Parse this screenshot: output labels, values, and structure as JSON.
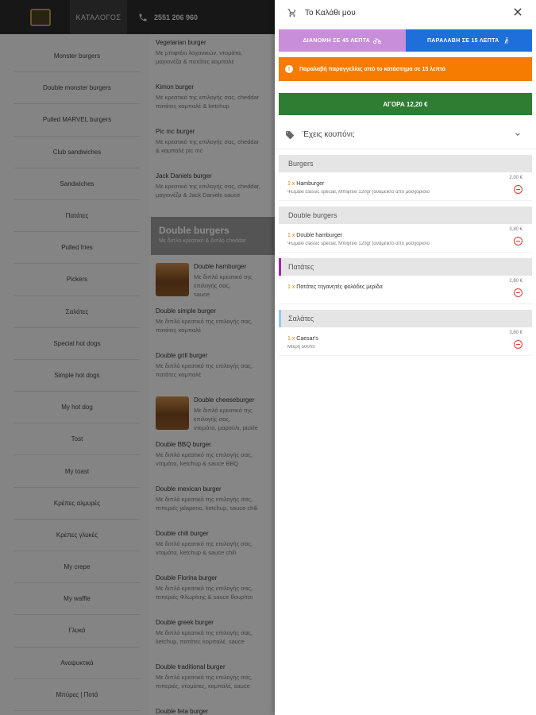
{
  "header": {
    "catalog_label": "ΚΑΤΑΛΟΓΟΣ",
    "phone": "2551 206 960"
  },
  "categories": [
    "Monster burgers",
    "Double monster burgers",
    "Pulled MARVEL burgers",
    "Club sandwiches",
    "Sandwiches",
    "Πατάτες",
    "Pulled fries",
    "Pickers",
    "Σαλάτες",
    "Special hot dogs",
    "Simple hot dogs",
    "My hot dog",
    "Tost",
    "My toast",
    "Κρέπες αλμυρές",
    "Κρέπες γλυκές",
    "My crepe",
    "My waffle",
    "Γλυκά",
    "Αναψυκτικά",
    "Μπύρες | Ποτά"
  ],
  "products_top": [
    {
      "name": "Vegetarian burger",
      "desc": "Με μπιφτέκι λαχανικών, ντομάτα,\nμαγιονέζα & πατάτες κομπαλέ"
    },
    {
      "name": "Kimon burger",
      "desc": "Με κρεατικό της επιλογής σας, cheddar\nπατάτες κομπαλέ & ketchup"
    },
    {
      "name": "Pic mc burger",
      "desc": "Με κρεατικό της επιλογής σας, cheddar\n& κομπαλέ pic mc"
    },
    {
      "name": "Jack Daniels burger",
      "desc": "Με κρεατικό της επιλογής σας, cheddar,\nμαγιονέζα & Jack Daniels sauce"
    }
  ],
  "section": {
    "title": "Double burgers",
    "subtitle": "Με διπλό κρεατικό & διπλό cheddar"
  },
  "products_double": [
    {
      "name": "Double hamburger",
      "desc": "Με διπλό κρεατικό της επιλογής σας,\nsauce",
      "img": true
    },
    {
      "name": "Double simple burger",
      "desc": "Με διπλό κρεατικό της επιλογής σας,\nπατάτες κομπαλέ"
    },
    {
      "name": "Double grill burger",
      "desc": "Με διπλό κρεατικό της επιλογής σας,\nπατάτες κομπαλέ"
    },
    {
      "name": "Double cheeseburger",
      "desc": "Με διπλό κρεατικό της επιλογής σας,\nντομάτα, μαρούλι, pickle",
      "img": true
    },
    {
      "name": "Double BBQ burger",
      "desc": "Με διπλό κρεατικό της επιλογής σας,\nντομάτα, ketchup & sauce BBQ"
    },
    {
      "name": "Double mexican burger",
      "desc": "Με διπλό κρεατικό της επιλογής σας,\nπιπεριές jalapeno, ketchup, sauce chili"
    },
    {
      "name": "Double chili burger",
      "desc": "Με διπλό κρεατικό της επιλογής σας,\nντομάτα, ketchup & sauce chili"
    },
    {
      "name": "Double Florina burger",
      "desc": "Με διπλό κρεατικό της επιλογής σας,\nπιπεριές Φλωρίνης & sauce θουρίτσι"
    },
    {
      "name": "Double greek burger",
      "desc": "Με διπλό κρεατικό της επιλογής σας,\nketchup, πατάτες κομπαλέ, sauce"
    },
    {
      "name": "Double traditional burger",
      "desc": "Με διπλό κρεατικό της επιλογής σας,\nπιπεριές, ντομάτες, κομπαλέ, sauce"
    },
    {
      "name": "Double feta burger",
      "desc": ""
    }
  ],
  "cart": {
    "title": "Το Καλάθι μου",
    "delivery_label": "ΔΙΑΝΟΜΗ ΣΕ 45 ΛΕΠΤΑ",
    "pickup_label": "ΠΑΡΑΛΑΒΗ ΣΕ 15 ΛΕΠΤΑ",
    "alert": "Παραλαβή παραγγελίας από το κατάστημα σε 15 λεπτά",
    "alert_icon": "!",
    "buy_label": "ΑΓΟΡΑ 12,20 €",
    "coupon_label": "Έχεις κουπόνι;",
    "colors": {
      "delivery": "#c98ed9",
      "pickup": "#1e6fd9",
      "alert": "#f57c00",
      "buy": "#2e7d32"
    },
    "groups": [
      {
        "name": "Burgers",
        "mark": "",
        "items": [
          {
            "qty": "1 x",
            "name": "Hamburger",
            "price": "2,00 €",
            "desc": "Ψωμάκι classic special, Μπιφτέκι 120gr (ανάμεικτο από μοσχαρίσιο"
          }
        ]
      },
      {
        "name": "Double burgers",
        "mark": "",
        "items": [
          {
            "qty": "1 x",
            "name": "Double hamburger",
            "price": "3,80 €",
            "desc": "Ψωμάκι classic special, Μπιφτέκι 120gr (ανάμεικτο από μοσχαρίσιο"
          }
        ]
      },
      {
        "name": "Πατάτες",
        "mark": "purple",
        "items": [
          {
            "qty": "1 x",
            "name": "Πατάτες τηγανητές φολάδες μερίδα",
            "price": "2,80 €",
            "desc": ""
          }
        ]
      },
      {
        "name": "Σαλάτες",
        "mark": "blue",
        "items": [
          {
            "qty": "1 x",
            "name": "Caesar's",
            "price": "3,80 €",
            "desc": "Μικρή 500ml"
          }
        ]
      }
    ]
  }
}
